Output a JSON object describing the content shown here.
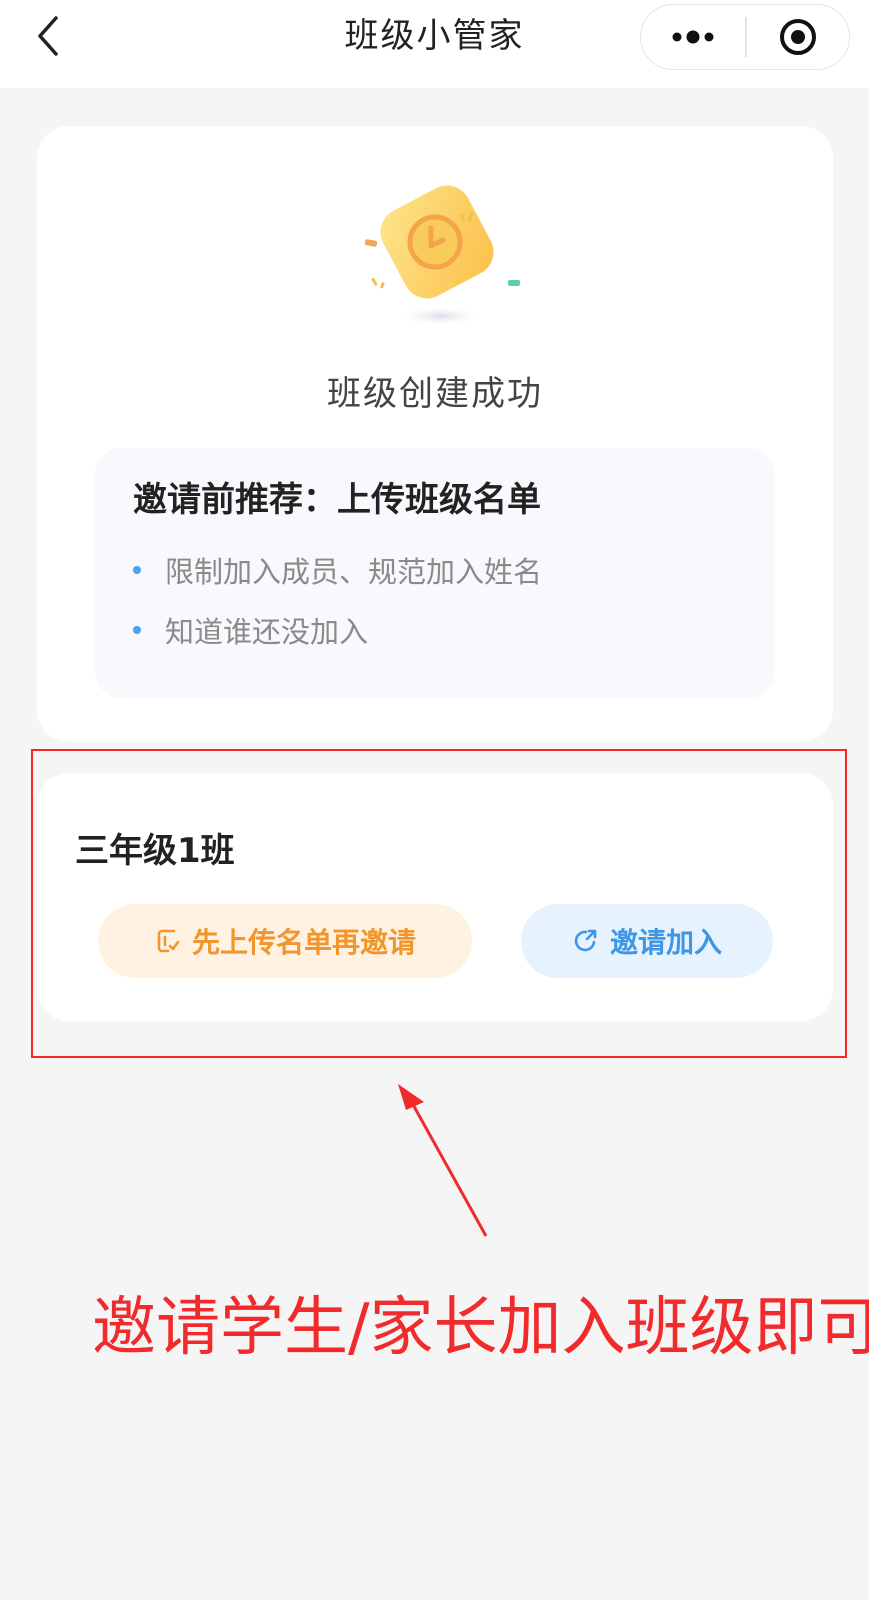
{
  "header": {
    "title": "班级小管家",
    "back_icon": "chevron-left-icon",
    "more_icon": "more-dots-icon",
    "close_icon": "target-circle-icon"
  },
  "success_card": {
    "illustration_icon": "clock-success-badge-icon",
    "title": "班级创建成功",
    "tip": {
      "title": "邀请前推荐：上传班级名单",
      "items": [
        "限制加入成员、规范加入姓名",
        "知道谁还没加入"
      ]
    }
  },
  "class_card": {
    "class_name": "三年级1班",
    "upload_button": {
      "icon": "upload-list-icon",
      "label": "先上传名单再邀请",
      "color": "#f0962c"
    },
    "invite_button": {
      "icon": "share-icon",
      "label": "邀请加入",
      "color": "#3f96e4"
    }
  },
  "annotation": {
    "text": "邀请学生/家长加入班级即可",
    "color": "#f12b2b"
  }
}
